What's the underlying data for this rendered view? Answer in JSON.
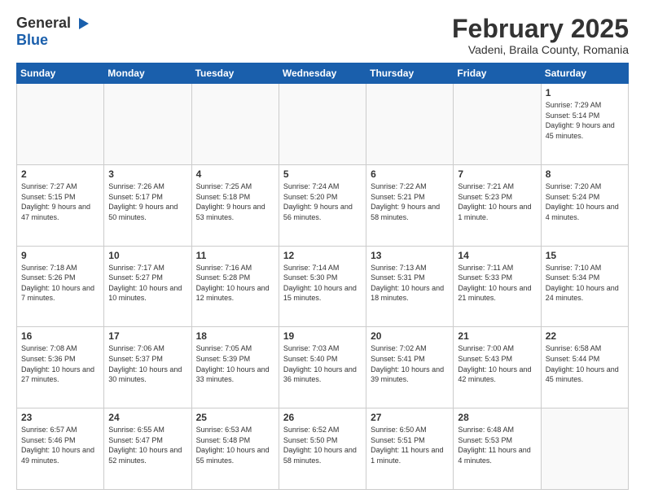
{
  "header": {
    "logo_general": "General",
    "logo_blue": "Blue",
    "title": "February 2025",
    "subtitle": "Vadeni, Braila County, Romania"
  },
  "days_of_week": [
    "Sunday",
    "Monday",
    "Tuesday",
    "Wednesday",
    "Thursday",
    "Friday",
    "Saturday"
  ],
  "weeks": [
    [
      {
        "day": "",
        "info": ""
      },
      {
        "day": "",
        "info": ""
      },
      {
        "day": "",
        "info": ""
      },
      {
        "day": "",
        "info": ""
      },
      {
        "day": "",
        "info": ""
      },
      {
        "day": "",
        "info": ""
      },
      {
        "day": "1",
        "info": "Sunrise: 7:29 AM\nSunset: 5:14 PM\nDaylight: 9 hours and 45 minutes."
      }
    ],
    [
      {
        "day": "2",
        "info": "Sunrise: 7:27 AM\nSunset: 5:15 PM\nDaylight: 9 hours and 47 minutes."
      },
      {
        "day": "3",
        "info": "Sunrise: 7:26 AM\nSunset: 5:17 PM\nDaylight: 9 hours and 50 minutes."
      },
      {
        "day": "4",
        "info": "Sunrise: 7:25 AM\nSunset: 5:18 PM\nDaylight: 9 hours and 53 minutes."
      },
      {
        "day": "5",
        "info": "Sunrise: 7:24 AM\nSunset: 5:20 PM\nDaylight: 9 hours and 56 minutes."
      },
      {
        "day": "6",
        "info": "Sunrise: 7:22 AM\nSunset: 5:21 PM\nDaylight: 9 hours and 58 minutes."
      },
      {
        "day": "7",
        "info": "Sunrise: 7:21 AM\nSunset: 5:23 PM\nDaylight: 10 hours and 1 minute."
      },
      {
        "day": "8",
        "info": "Sunrise: 7:20 AM\nSunset: 5:24 PM\nDaylight: 10 hours and 4 minutes."
      }
    ],
    [
      {
        "day": "9",
        "info": "Sunrise: 7:18 AM\nSunset: 5:26 PM\nDaylight: 10 hours and 7 minutes."
      },
      {
        "day": "10",
        "info": "Sunrise: 7:17 AM\nSunset: 5:27 PM\nDaylight: 10 hours and 10 minutes."
      },
      {
        "day": "11",
        "info": "Sunrise: 7:16 AM\nSunset: 5:28 PM\nDaylight: 10 hours and 12 minutes."
      },
      {
        "day": "12",
        "info": "Sunrise: 7:14 AM\nSunset: 5:30 PM\nDaylight: 10 hours and 15 minutes."
      },
      {
        "day": "13",
        "info": "Sunrise: 7:13 AM\nSunset: 5:31 PM\nDaylight: 10 hours and 18 minutes."
      },
      {
        "day": "14",
        "info": "Sunrise: 7:11 AM\nSunset: 5:33 PM\nDaylight: 10 hours and 21 minutes."
      },
      {
        "day": "15",
        "info": "Sunrise: 7:10 AM\nSunset: 5:34 PM\nDaylight: 10 hours and 24 minutes."
      }
    ],
    [
      {
        "day": "16",
        "info": "Sunrise: 7:08 AM\nSunset: 5:36 PM\nDaylight: 10 hours and 27 minutes."
      },
      {
        "day": "17",
        "info": "Sunrise: 7:06 AM\nSunset: 5:37 PM\nDaylight: 10 hours and 30 minutes."
      },
      {
        "day": "18",
        "info": "Sunrise: 7:05 AM\nSunset: 5:39 PM\nDaylight: 10 hours and 33 minutes."
      },
      {
        "day": "19",
        "info": "Sunrise: 7:03 AM\nSunset: 5:40 PM\nDaylight: 10 hours and 36 minutes."
      },
      {
        "day": "20",
        "info": "Sunrise: 7:02 AM\nSunset: 5:41 PM\nDaylight: 10 hours and 39 minutes."
      },
      {
        "day": "21",
        "info": "Sunrise: 7:00 AM\nSunset: 5:43 PM\nDaylight: 10 hours and 42 minutes."
      },
      {
        "day": "22",
        "info": "Sunrise: 6:58 AM\nSunset: 5:44 PM\nDaylight: 10 hours and 45 minutes."
      }
    ],
    [
      {
        "day": "23",
        "info": "Sunrise: 6:57 AM\nSunset: 5:46 PM\nDaylight: 10 hours and 49 minutes."
      },
      {
        "day": "24",
        "info": "Sunrise: 6:55 AM\nSunset: 5:47 PM\nDaylight: 10 hours and 52 minutes."
      },
      {
        "day": "25",
        "info": "Sunrise: 6:53 AM\nSunset: 5:48 PM\nDaylight: 10 hours and 55 minutes."
      },
      {
        "day": "26",
        "info": "Sunrise: 6:52 AM\nSunset: 5:50 PM\nDaylight: 10 hours and 58 minutes."
      },
      {
        "day": "27",
        "info": "Sunrise: 6:50 AM\nSunset: 5:51 PM\nDaylight: 11 hours and 1 minute."
      },
      {
        "day": "28",
        "info": "Sunrise: 6:48 AM\nSunset: 5:53 PM\nDaylight: 11 hours and 4 minutes."
      },
      {
        "day": "",
        "info": ""
      }
    ]
  ]
}
